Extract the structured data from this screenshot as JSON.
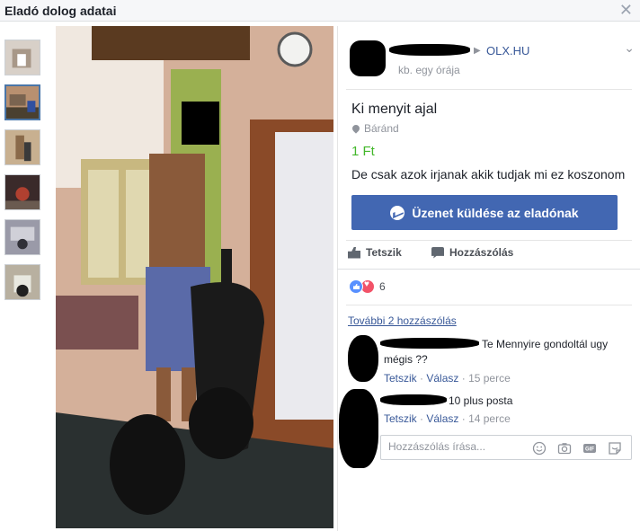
{
  "window": {
    "title": "Eladó dolog adatai",
    "close_icon": "close-icon"
  },
  "thumbnails": [
    {
      "name": "thumb-1",
      "active": false
    },
    {
      "name": "thumb-2",
      "active": true
    },
    {
      "name": "thumb-3",
      "active": false
    },
    {
      "name": "thumb-4",
      "active": false
    },
    {
      "name": "thumb-5",
      "active": false
    },
    {
      "name": "thumb-6",
      "active": false
    }
  ],
  "post": {
    "source": "OLX.HU",
    "time": "kb. egy órája",
    "title": "Ki menyit ajal",
    "location": "Báránd",
    "price": "1 Ft",
    "description": "De csak azok irjanak akik tudjak mi ez koszonom",
    "send_button": "Üzenet küldése az eladónak"
  },
  "actions": {
    "like": "Tetszik",
    "comment": "Hozzászólás"
  },
  "reactions": {
    "count": "6"
  },
  "comments": {
    "more_link": "További 2 hozzászólás",
    "items": [
      {
        "text_line1": "Te Mennyire gondoltál ugy",
        "text_line2": "mégis ??",
        "like": "Tetszik",
        "reply": "Válasz",
        "time": "15 perce"
      },
      {
        "text_line1": "10 plus posta",
        "like": "Tetszik",
        "reply": "Válasz",
        "time": "14 perce"
      }
    ],
    "compose_placeholder": "Hozzászólás írása..."
  },
  "colors": {
    "accent": "#4267b2",
    "price": "#42b72a",
    "link": "#385898"
  }
}
